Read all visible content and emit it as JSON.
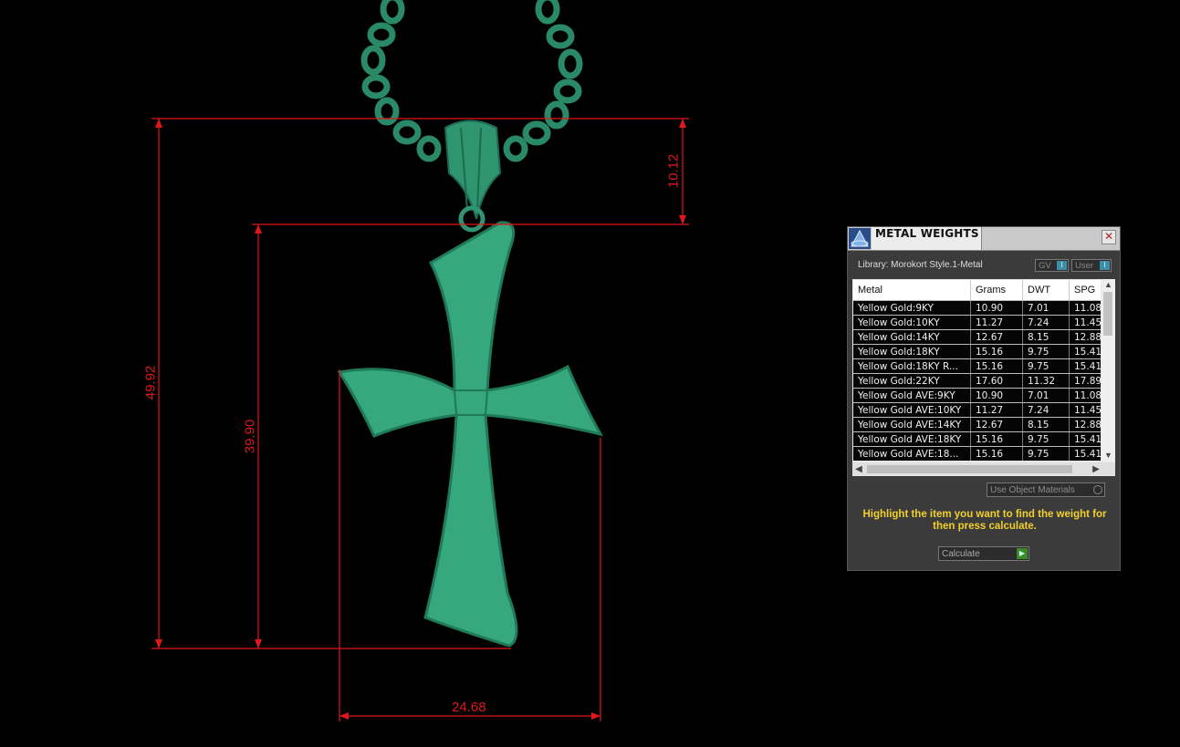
{
  "dimensions": {
    "overall_height": "49.92",
    "cross_height": "39.90",
    "bail_height": "10.12",
    "width": "24.68"
  },
  "colors": {
    "model": "#35a57d",
    "dimension_lines": "#e0161c",
    "hint_text": "#f2cf2a"
  },
  "panel": {
    "title": "METAL WEIGHTS",
    "close_glyph": "✕",
    "library": "Library: Morokort Style.1-Metal",
    "toggle_gv": "GV",
    "toggle_user": "User",
    "toggle_glyph": "I",
    "columns": [
      "Metal",
      "Grams",
      "DWT",
      "SPG"
    ],
    "rows": [
      [
        "Yellow Gold:9KY",
        "10.90",
        "7.01",
        "11.08"
      ],
      [
        "Yellow Gold:10KY",
        "11.27",
        "7.24",
        "11.45"
      ],
      [
        "Yellow Gold:14KY",
        "12.67",
        "8.15",
        "12.88"
      ],
      [
        "Yellow Gold:18KY",
        "15.16",
        "9.75",
        "15.41"
      ],
      [
        "Yellow Gold:18KY R...",
        "15.16",
        "9.75",
        "15.41"
      ],
      [
        "Yellow Gold:22KY",
        "17.60",
        "11.32",
        "17.89"
      ],
      [
        "Yellow Gold AVE:9KY",
        "10.90",
        "7.01",
        "11.08"
      ],
      [
        "Yellow Gold AVE:10KY",
        "11.27",
        "7.24",
        "11.45"
      ],
      [
        "Yellow Gold AVE:14KY",
        "12.67",
        "8.15",
        "12.88"
      ],
      [
        "Yellow Gold AVE:18KY",
        "15.16",
        "9.75",
        "15.41"
      ],
      [
        "Yellow Gold AVE:18...",
        "15.16",
        "9.75",
        "15.41"
      ]
    ],
    "use_object_materials": "Use Object Materials",
    "hint": "Highlight the item you want to find the weight for then press calculate.",
    "calculate": "Calculate"
  }
}
